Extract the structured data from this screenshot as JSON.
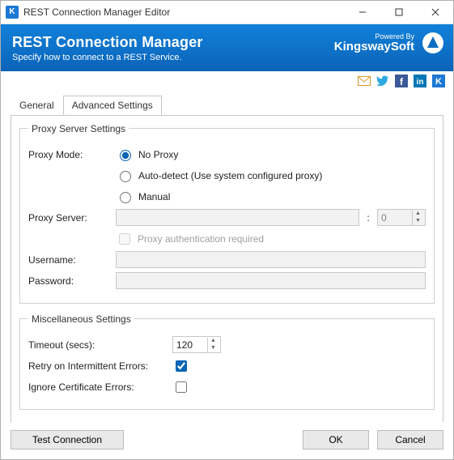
{
  "window": {
    "title": "REST Connection Manager Editor"
  },
  "banner": {
    "title": "REST Connection Manager",
    "subtitle": "Specify how to connect to a REST Service.",
    "poweredBy": "Powered By",
    "brand": "KingswaySoft"
  },
  "tabs": {
    "general": "General",
    "advanced": "Advanced Settings"
  },
  "proxy": {
    "legend": "Proxy Server Settings",
    "modeLabel": "Proxy Mode:",
    "opt_noProxy": "No Proxy",
    "opt_auto": "Auto-detect (Use system configured proxy)",
    "opt_manual": "Manual",
    "serverLabel": "Proxy Server:",
    "serverValue": "",
    "portValue": "0",
    "authLabel": "Proxy authentication required",
    "usernameLabel": "Username:",
    "usernameValue": "",
    "passwordLabel": "Password:",
    "passwordValue": ""
  },
  "misc": {
    "legend": "Miscellaneous Settings",
    "timeoutLabel": "Timeout (secs):",
    "timeoutValue": "120",
    "retryLabel": "Retry on Intermittent Errors:",
    "ignoreCertLabel": "Ignore Certificate Errors:"
  },
  "footer": {
    "test": "Test Connection",
    "ok": "OK",
    "cancel": "Cancel"
  }
}
